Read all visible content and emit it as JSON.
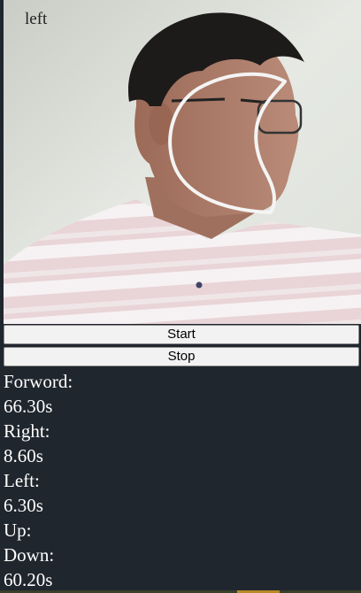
{
  "camera": {
    "direction_label": "left"
  },
  "controls": {
    "start_label": "Start",
    "stop_label": "Stop"
  },
  "stats": [
    {
      "label": "Forword:",
      "value": "66.30s"
    },
    {
      "label": "Right:",
      "value": "8.60s"
    },
    {
      "label": "Left:",
      "value": "6.30s"
    },
    {
      "label": "Up:",
      "value": ""
    },
    {
      "label": "Down:",
      "value": "60.20s"
    }
  ],
  "colors": {
    "page_background": "#20262e",
    "text": "#ffffff",
    "overlay_outline": "#f4f4f4"
  }
}
